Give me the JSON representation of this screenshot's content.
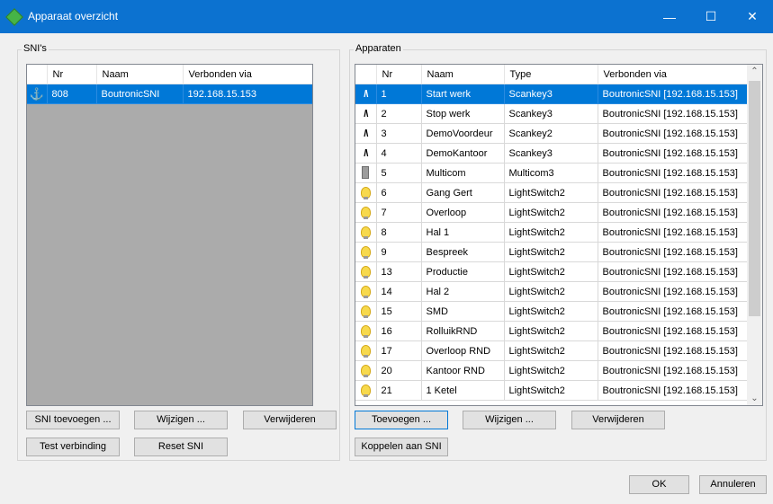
{
  "window": {
    "title": "Apparaat overzicht",
    "minimize": "—",
    "maximize": "☐",
    "close": "✕"
  },
  "sni": {
    "group_label": "SNI's",
    "columns": [
      "Nr",
      "Naam",
      "Verbonden via"
    ],
    "rows": [
      {
        "nr": "808",
        "naam": "BoutronicSNI",
        "verbonden": "192.168.15.153",
        "selected": true
      }
    ],
    "buttons": {
      "add": "SNI toevoegen ...",
      "edit": "Wijzigen ...",
      "delete": "Verwijderen",
      "test": "Test verbinding",
      "reset": "Reset SNI"
    }
  },
  "devices": {
    "group_label": "Apparaten",
    "columns": [
      "Nr",
      "Naam",
      "Type",
      "Verbonden via"
    ],
    "rows": [
      {
        "icon": "scankey-icon",
        "nr": "1",
        "naam": "Start werk",
        "type": "Scankey3",
        "verbonden": "BoutronicSNI [192.168.15.153]",
        "selected": true
      },
      {
        "icon": "scankey-icon",
        "nr": "2",
        "naam": "Stop werk",
        "type": "Scankey3",
        "verbonden": "BoutronicSNI [192.168.15.153]"
      },
      {
        "icon": "scankey-icon",
        "nr": "3",
        "naam": "DemoVoordeur",
        "type": "Scankey2",
        "verbonden": "BoutronicSNI [192.168.15.153]"
      },
      {
        "icon": "scankey-icon",
        "nr": "4",
        "naam": "DemoKantoor",
        "type": "Scankey3",
        "verbonden": "BoutronicSNI [192.168.15.153]"
      },
      {
        "icon": "multicom-icon",
        "nr": "5",
        "naam": "Multicom",
        "type": "Multicom3",
        "verbonden": "BoutronicSNI [192.168.15.153]"
      },
      {
        "icon": "lightbulb-icon",
        "nr": "6",
        "naam": "Gang Gert",
        "type": "LightSwitch2",
        "verbonden": "BoutronicSNI [192.168.15.153]"
      },
      {
        "icon": "lightbulb-icon",
        "nr": "7",
        "naam": "Overloop",
        "type": "LightSwitch2",
        "verbonden": "BoutronicSNI [192.168.15.153]"
      },
      {
        "icon": "lightbulb-icon",
        "nr": "8",
        "naam": "Hal 1",
        "type": "LightSwitch2",
        "verbonden": "BoutronicSNI [192.168.15.153]"
      },
      {
        "icon": "lightbulb-icon",
        "nr": "9",
        "naam": "Bespreek",
        "type": "LightSwitch2",
        "verbonden": "BoutronicSNI [192.168.15.153]"
      },
      {
        "icon": "lightbulb-icon",
        "nr": "13",
        "naam": "Productie",
        "type": "LightSwitch2",
        "verbonden": "BoutronicSNI [192.168.15.153]"
      },
      {
        "icon": "lightbulb-icon",
        "nr": "14",
        "naam": "Hal 2",
        "type": "LightSwitch2",
        "verbonden": "BoutronicSNI [192.168.15.153]"
      },
      {
        "icon": "lightbulb-icon",
        "nr": "15",
        "naam": "SMD",
        "type": "LightSwitch2",
        "verbonden": "BoutronicSNI [192.168.15.153]"
      },
      {
        "icon": "lightbulb-icon",
        "nr": "16",
        "naam": "RolluikRND",
        "type": "LightSwitch2",
        "verbonden": "BoutronicSNI [192.168.15.153]"
      },
      {
        "icon": "lightbulb-icon",
        "nr": "17",
        "naam": "Overloop RND",
        "type": "LightSwitch2",
        "verbonden": "BoutronicSNI [192.168.15.153]"
      },
      {
        "icon": "lightbulb-icon",
        "nr": "20",
        "naam": "Kantoor RND",
        "type": "LightSwitch2",
        "verbonden": "BoutronicSNI [192.168.15.153]"
      },
      {
        "icon": "lightbulb-icon",
        "nr": "21",
        "naam": "1 Ketel",
        "type": "LightSwitch2",
        "verbonden": "BoutronicSNI [192.168.15.153]"
      }
    ],
    "buttons": {
      "add": "Toevoegen ...",
      "edit": "Wijzigen ...",
      "delete": "Verwijderen",
      "link": "Koppelen aan SNI"
    }
  },
  "dialog": {
    "ok": "OK",
    "cancel": "Annuleren"
  }
}
